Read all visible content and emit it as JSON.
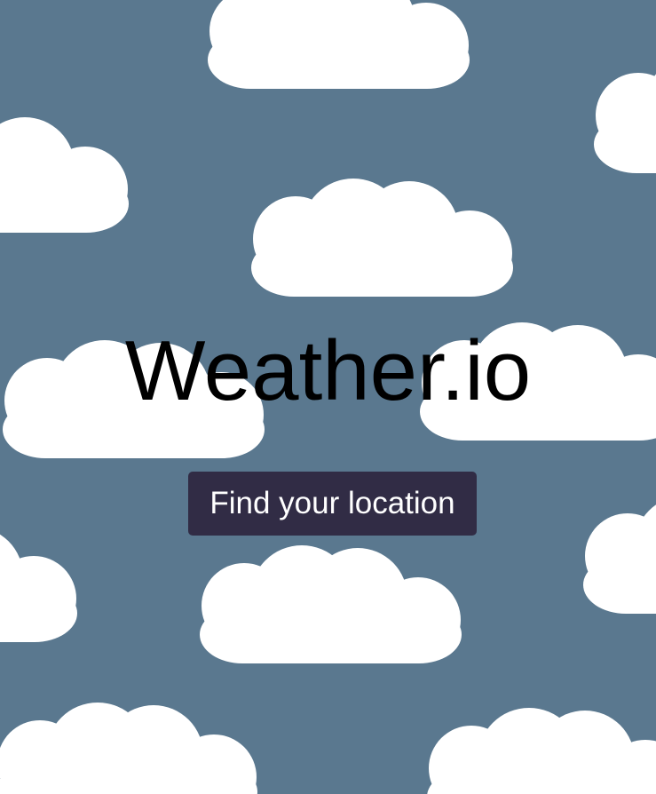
{
  "app": {
    "title": "Weather.io"
  },
  "actions": {
    "find_location_label": "Find your location"
  },
  "colors": {
    "sky": "#5a788f",
    "cloud": "#ffffff",
    "button_bg": "#312c45",
    "button_text": "#ffffff",
    "title_text": "#000000"
  },
  "background": {
    "pattern_icon": "cloud-icon"
  }
}
